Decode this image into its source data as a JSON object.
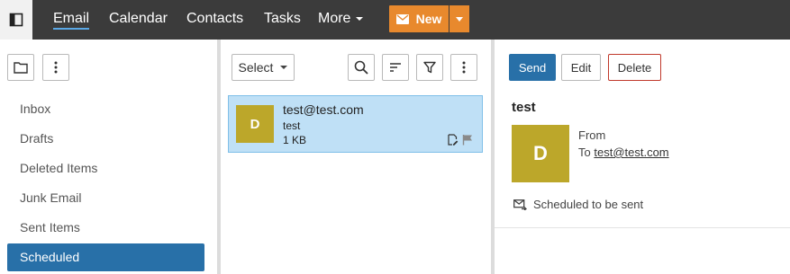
{
  "nav": {
    "items": [
      {
        "label": "Email",
        "active": true
      },
      {
        "label": "Calendar",
        "active": false
      },
      {
        "label": "Contacts",
        "active": false
      },
      {
        "label": "Tasks",
        "active": false
      },
      {
        "label": "More",
        "active": false
      }
    ],
    "new_label": "New"
  },
  "folders": {
    "items": [
      {
        "label": "Inbox",
        "active": false
      },
      {
        "label": "Drafts",
        "active": false
      },
      {
        "label": "Deleted Items",
        "active": false
      },
      {
        "label": "Junk Email",
        "active": false
      },
      {
        "label": "Sent Items",
        "active": false
      },
      {
        "label": "Scheduled",
        "active": true
      }
    ]
  },
  "list": {
    "select_label": "Select",
    "messages": [
      {
        "avatar": "D",
        "from": "test@test.com",
        "subject": "test",
        "size": "1 KB"
      }
    ]
  },
  "reading": {
    "send_label": "Send",
    "edit_label": "Edit",
    "delete_label": "Delete",
    "subject": "test",
    "avatar": "D",
    "from_label": "From",
    "to_label": "To",
    "to_address": "test@test.com",
    "status": "Scheduled to be sent"
  },
  "colors": {
    "topbar": "#3b3b3b",
    "accent_new": "#e8892d",
    "selected_folder": "#2870a8",
    "selected_message": "#bfe0f6",
    "avatar": "#bca72a",
    "delete_border": "#c0392b"
  }
}
